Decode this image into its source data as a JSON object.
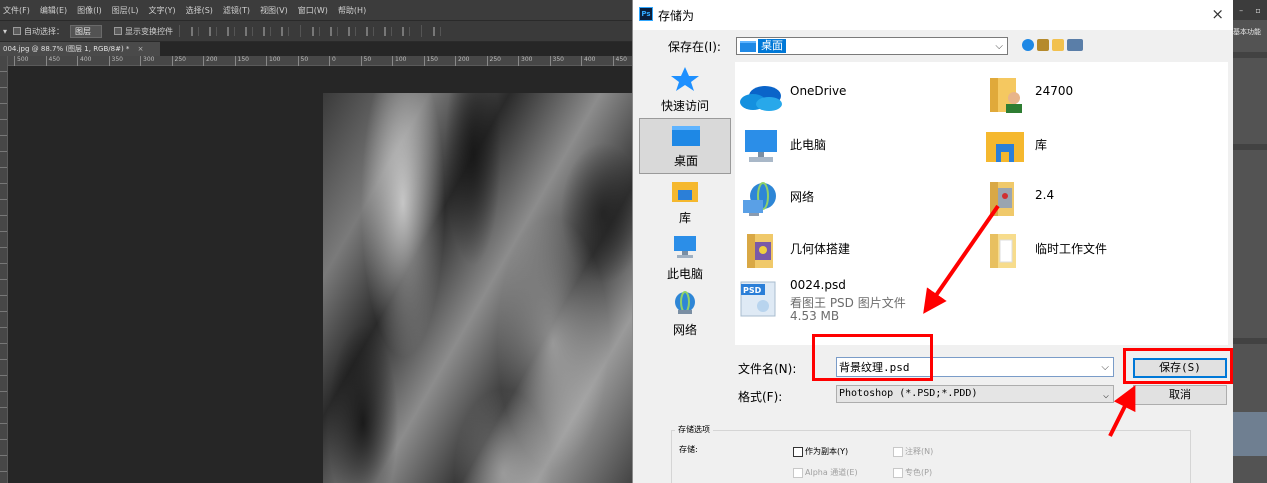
{
  "photoshop": {
    "menu": [
      "文件(F)",
      "编辑(E)",
      "图像(I)",
      "图层(L)",
      "文字(Y)",
      "选择(S)",
      "滤镜(T)",
      "视图(V)",
      "窗口(W)",
      "帮助(H)"
    ],
    "options": {
      "auto_select_label": "自动选择：",
      "auto_select_value": "图层",
      "show_transform_label": "显示变换控件"
    },
    "doc_tab": "004.jpg @ 88.7% (图层 1, RGB/8#) *",
    "doc_tab_close": "×",
    "ruler_ticks": [
      "500",
      "450",
      "400",
      "350",
      "300",
      "250",
      "200",
      "150",
      "100",
      "50",
      "0",
      "50",
      "100",
      "150",
      "200",
      "250",
      "300",
      "350",
      "400",
      "450"
    ],
    "workspace_label": "基本功能"
  },
  "dialog": {
    "title": "存储为",
    "close_glyph": "×",
    "save_in_label": "保存在(I):",
    "save_in_value": "桌面",
    "places": [
      {
        "label": "快速访问",
        "icon": "star-icon"
      },
      {
        "label": "桌面",
        "icon": "desktop-icon",
        "selected": true
      },
      {
        "label": "库",
        "icon": "library-icon"
      },
      {
        "label": "此电脑",
        "icon": "computer-icon"
      },
      {
        "label": "网络",
        "icon": "network-icon"
      }
    ],
    "files": [
      {
        "name": "OneDrive",
        "icon": "onedrive-icon"
      },
      {
        "name": "24700",
        "icon": "user-folder-icon"
      },
      {
        "name": "此电脑",
        "icon": "computer-icon"
      },
      {
        "name": "库",
        "icon": "library-icon"
      },
      {
        "name": "网络",
        "icon": "network-icon"
      },
      {
        "name": "2.4",
        "icon": "folder-icon"
      },
      {
        "name": "几何体搭建",
        "icon": "folder-icon"
      },
      {
        "name": "临时工作文件",
        "icon": "folder-icon"
      },
      {
        "name": "0024.psd",
        "type": "看图王 PSD 图片文件",
        "size": "4.53 MB",
        "icon": "psd-file-icon"
      }
    ],
    "filename_label": "文件名(N):",
    "filename_value": "背景纹理.psd",
    "format_label": "格式(F):",
    "format_value": "Photoshop (*.PSD;*.PDD)",
    "save_button": "保存(S)",
    "cancel_button": "取消",
    "options_title": "存储选项",
    "options_store_label": "存储:",
    "options": [
      {
        "label": "作为副本(Y)",
        "enabled": true
      },
      {
        "label": "注释(N)",
        "enabled": false
      },
      {
        "label": "Alpha 通道(E)",
        "enabled": false
      },
      {
        "label": "专色(P)",
        "enabled": false
      }
    ]
  },
  "colors": {
    "annotation_red": "#ff0000",
    "selection_blue": "#0078d7",
    "ps_dark": "#262626"
  }
}
